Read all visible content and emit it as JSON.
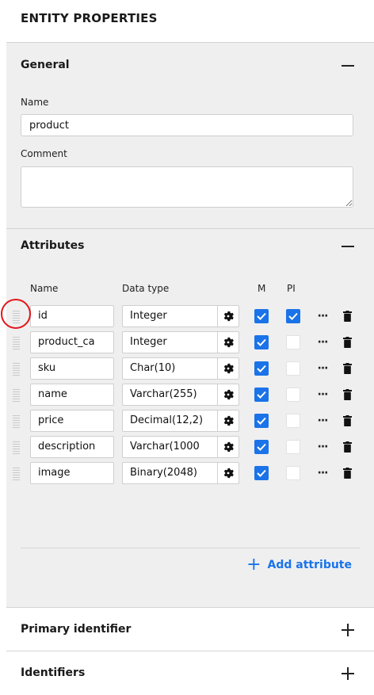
{
  "panel": {
    "title": "ENTITY PROPERTIES"
  },
  "general": {
    "header": "General",
    "name_label": "Name",
    "name_value": "product",
    "comment_label": "Comment",
    "comment_value": ""
  },
  "attributes": {
    "header": "Attributes",
    "columns": {
      "name": "Name",
      "data_type": "Data type",
      "m": "M",
      "pi": "PI"
    },
    "rows": [
      {
        "name": "id",
        "type": "Integer",
        "m": true,
        "pi": true
      },
      {
        "name": "product_ca",
        "type": "Integer",
        "m": true,
        "pi": false
      },
      {
        "name": "sku",
        "type": "Char(10)",
        "m": true,
        "pi": false
      },
      {
        "name": "name",
        "type": "Varchar(255)",
        "m": true,
        "pi": false
      },
      {
        "name": "price",
        "type": "Decimal(12,2)",
        "m": true,
        "pi": false
      },
      {
        "name": "description",
        "type": "Varchar(1000",
        "m": true,
        "pi": false
      },
      {
        "name": "image",
        "type": "Binary(2048)",
        "m": true,
        "pi": false
      }
    ],
    "add_label": "Add attribute",
    "more_label": "···"
  },
  "primary_identifier": {
    "header": "Primary identifier"
  },
  "identifiers": {
    "header": "Identifiers"
  },
  "colors": {
    "accent": "#1a73e8",
    "highlight": "#e4161b",
    "section_bg": "#efefef"
  }
}
